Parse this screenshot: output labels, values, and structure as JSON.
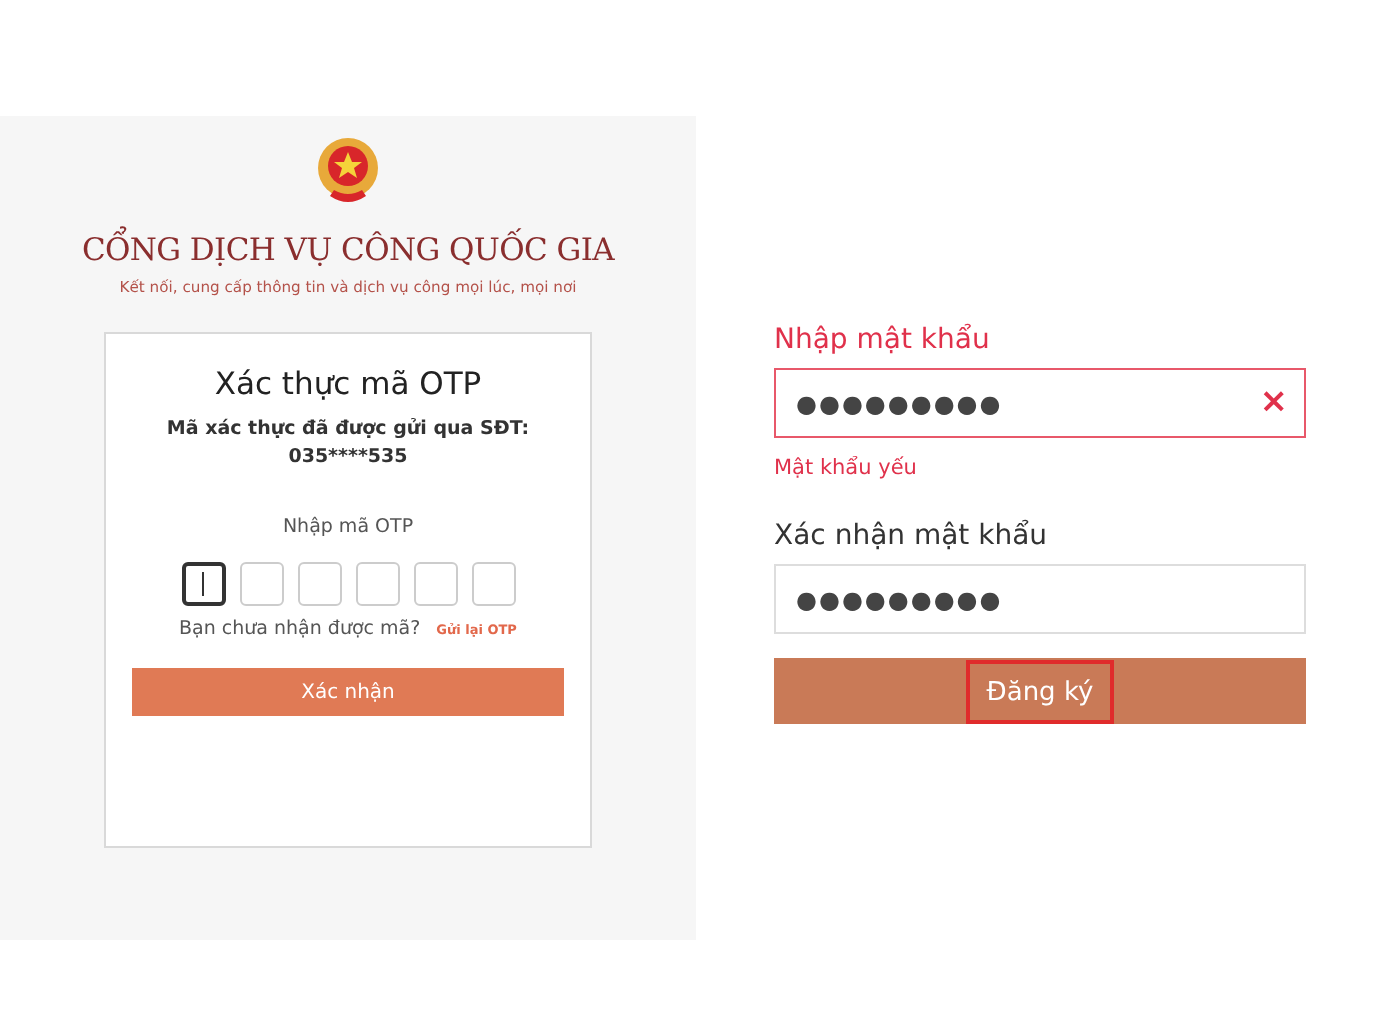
{
  "left_screen": {
    "portal_title": "CỔNG DỊCH VỤ CÔNG QUỐC GIA",
    "tagline": "Kết nối, cung cấp thông tin và dịch vụ công mọi lúc, mọi nơi",
    "otp_card": {
      "title": "Xác thực mã OTP",
      "message": "Mã xác thực đã được gửi qua SĐT:",
      "phone": "035****535",
      "otp_label": "Nhập mã OTP",
      "otp_boxes": [
        {
          "focused": true
        },
        {
          "focused": false
        },
        {
          "focused": false
        },
        {
          "focused": false
        },
        {
          "focused": false
        },
        {
          "focused": false
        }
      ],
      "resend_prompt": "Bạn chưa nhận được mã?",
      "resend_link": "Gửi lại OTP",
      "confirm_button": "Xác nhận"
    }
  },
  "right_screen": {
    "fields": [
      {
        "label": "Nhập mật khẩu",
        "value": "●●●●●●●●●",
        "invalid": true,
        "clear_icon": "×",
        "error": "Mật khẩu yếu"
      },
      {
        "label": "Xác nhận mật khẩu",
        "value": "●●●●●●●●●",
        "invalid": false
      }
    ],
    "register_button": {
      "label": "Đăng ký",
      "highlighted": true
    }
  }
}
